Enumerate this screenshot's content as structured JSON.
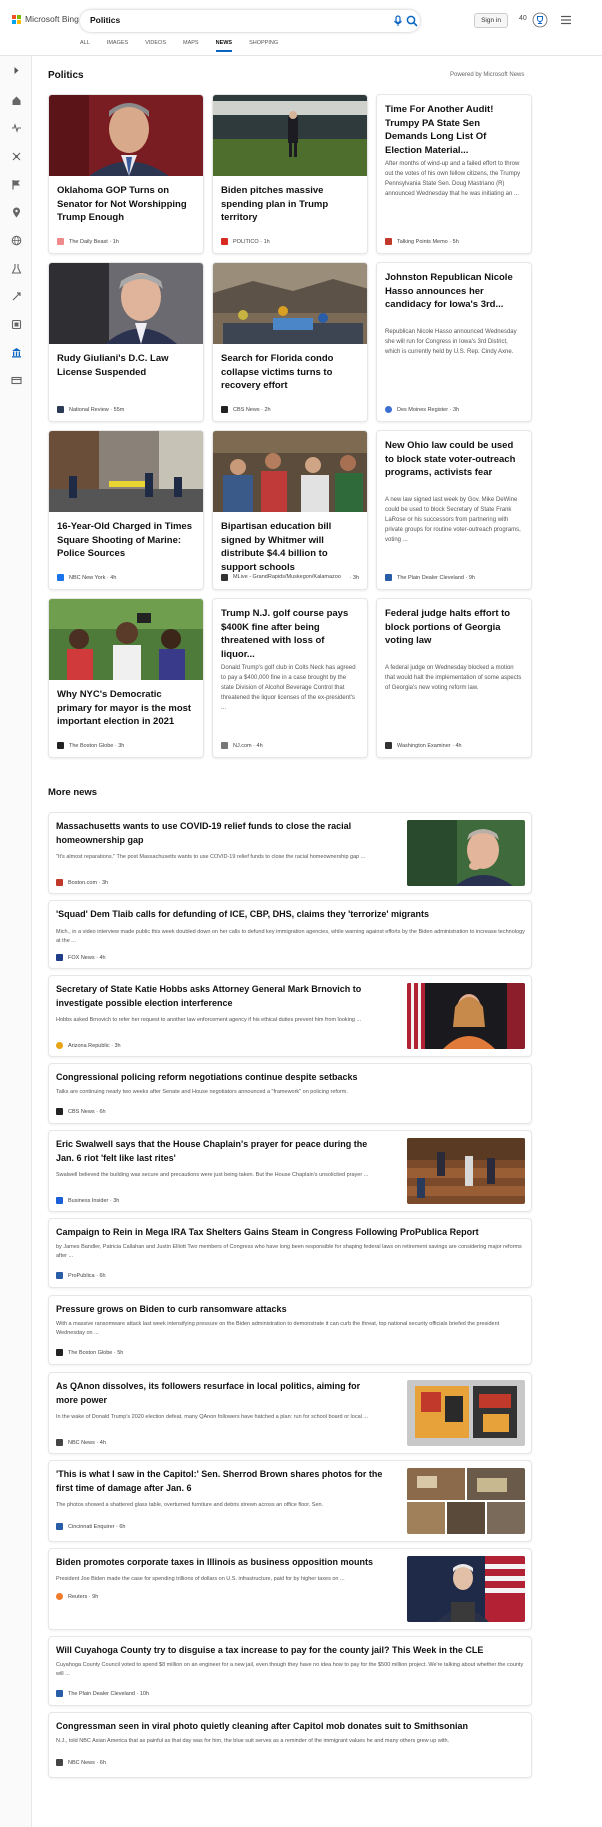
{
  "header": {
    "logo_text": "Microsoft Bing",
    "query": "Politics",
    "signin_label": "Sign in",
    "points": "40",
    "tabs": [
      "ALL",
      "IMAGES",
      "VIDEOS",
      "MAPS",
      "NEWS",
      "SHOPPING"
    ],
    "active_tab": "NEWS"
  },
  "rail_icons": [
    "expand-icon",
    "home-icon",
    "us-news-icon",
    "world-icon",
    "flag-icon",
    "local-icon",
    "globe-icon",
    "science-icon",
    "technology-icon",
    "entertainment-icon",
    "politics-icon",
    "money-icon"
  ],
  "section": {
    "title": "Politics",
    "powered_by": "Powered by Microsoft News"
  },
  "top_cards": [
    {
      "title": "Oklahoma GOP Turns on Senator for Not Worshipping Trump Enough",
      "source": "The Daily Beast",
      "age": "1h",
      "has_image": true,
      "fav_color": "#f08a8a"
    },
    {
      "title": "Biden pitches massive spending plan in Trump territory",
      "source": "POLITICO",
      "age": "1h",
      "has_image": true,
      "fav_color": "#d72a20"
    },
    {
      "title": "Time For Another Audit! Trumpy PA State Sen Demands Long List Of Election Material...",
      "snippet": "After months of wind-up and a failed effort to throw out the votes of his own fellow citizens, the Trumpy Pennsylvania State Sen. Doug Mastriano (R) announced Wednesday that he was initiating an ...",
      "source": "Talking Points Memo",
      "age": "5h",
      "has_image": false,
      "fav_color": "#c0392b"
    },
    {
      "title": "Rudy Giuliani's D.C. Law License Suspended",
      "source": "National Review",
      "age": "55m",
      "has_image": true,
      "fav_color": "#2b3a55"
    },
    {
      "title": "Search for Florida condo collapse victims turns to recovery effort",
      "source": "CBS News",
      "age": "2h",
      "has_image": true,
      "fav_color": "#222222"
    },
    {
      "title": "Johnston Republican Nicole Hasso announces her candidacy for Iowa's 3rd...",
      "snippet": "Republican Nicole Hasso announced Wednesday she will run for Congress in Iowa's 3rd District, which is currently held by U.S. Rep. Cindy Axne.",
      "source": "Des Moines Register",
      "age": "3h",
      "has_image": false,
      "fav_color": "#3b6fd1"
    },
    {
      "title": "16-Year-Old Charged in Times Square Shooting of Marine: Police Sources",
      "source": "NBC New York",
      "age": "4h",
      "has_image": true,
      "fav_color": "#1a73e8"
    },
    {
      "title": "Bipartisan education bill signed by Whitmer will distribute $4.4 billion to support schools",
      "source": "MLive - GrandRapids/Muskegon/Kalamazoo",
      "age": "3h",
      "has_image": true,
      "fav_color": "#333333"
    },
    {
      "title": "New Ohio law could be used to block state voter-outreach programs, activists fear",
      "snippet": "A new law signed last week by Gov. Mike DeWine could be used to block Secretary of State Frank LaRose or his successors from partnering with private groups for routine voter-outreach programs, voting ...",
      "source": "The Plain Dealer Cleveland",
      "age": "9h",
      "has_image": false,
      "fav_color": "#2a5da8"
    },
    {
      "title": "Why NYC's Democratic primary for mayor is the most important election in 2021",
      "source": "The Boston Globe",
      "age": "3h",
      "has_image": true,
      "fav_color": "#222222"
    },
    {
      "title": "Trump N.J. golf course pays $400K fine after being threatened with loss of liquor...",
      "snippet": "Donald Trump's golf club in Colts Neck has agreed to pay a $400,000 fine in a case brought by the state Division of Alcohol Beverage Control that threatened the liquor licenses of the ex-president's ...",
      "source": "NJ.com",
      "age": "4h",
      "has_image": false,
      "fav_color": "#777777"
    },
    {
      "title": "Federal judge halts effort to block portions of Georgia voting law",
      "snippet": "A federal judge on Wednesday blocked a motion that would halt the implementation of some aspects of Georgia's new voting reform law.",
      "source": "Washington Examiner",
      "age": "4h",
      "has_image": false,
      "fav_color": "#333333"
    }
  ],
  "more_news": {
    "title": "More news",
    "items": [
      {
        "title": "Massachusetts wants to use COVID-19 relief funds to close the racial homeownership gap",
        "snippet": "\"It's almost reparations.\" The post Massachusetts wants to use COVID-19 relief funds to close the racial homeownership gap ...",
        "source": "Boston.com",
        "age": "3h",
        "has_image": true,
        "fav_color": "#c0392b"
      },
      {
        "title": "'Squad' Dem Tlaib calls for defunding of ICE, CBP, DHS, claims they 'terrorize' migrants",
        "snippet": "Mich., in a video interview made public this week doubled down on her calls to defund key immigration agencies, while warning against efforts by the Biden administration to increase technology at the ...",
        "source": "FOX News",
        "age": "4h",
        "has_image": false,
        "fav_color": "#1f3c88"
      },
      {
        "title": "Secretary of State Katie Hobbs asks Attorney General Mark Brnovich to investigate possible election interference",
        "snippet": "Hobbs asked Brnovich to refer her request to another law enforcement agency if his ethical duties prevent him from looking ...",
        "source": "Arizona Republic",
        "age": "3h",
        "has_image": true,
        "fav_color": "#e8a317"
      },
      {
        "title": "Congressional policing reform negotiations continue despite setbacks",
        "snippet": "Talks are continuing nearly two weeks after Senate and House negotiators announced a \"framework\" on policing reform.",
        "source": "CBS News",
        "age": "6h",
        "has_image": false,
        "fav_color": "#222222"
      },
      {
        "title": "Eric Swalwell says that the House Chaplain's prayer for peace during the Jan. 6 riot 'felt like last rites'",
        "snippet": "Swalwell believed the building was secure and precautions were just being taken. But the House Chaplain's unsolicited prayer ...",
        "source": "Business Insider",
        "age": "3h",
        "has_image": true,
        "fav_color": "#1a5fd6"
      },
      {
        "title": "Campaign to Rein in Mega IRA Tax Shelters Gains Steam in Congress Following ProPublica Report",
        "snippet": "by James Bandler, Patricia Callahan and Justin Elliott Two members of Congress who have long been responsible for shaping federal laws on retirement savings are considering major reforms after ...",
        "source": "ProPublica",
        "age": "6h",
        "has_image": false,
        "fav_color": "#2a5da8"
      },
      {
        "title": "Pressure grows on Biden to curb ransomware attacks",
        "snippet": "With a massive ransomware attack last week intensifying pressure on the Biden administration to demonstrate it can curb the threat, top national security officials briefed the president Wednesday on ...",
        "source": "The Boston Globe",
        "age": "5h",
        "has_image": false,
        "fav_color": "#222222"
      },
      {
        "title": "As QAnon dissolves, its followers resurface in local politics, aiming for more power",
        "snippet": "In the wake of Donald Trump's 2020 election defeat, many QAnon followers have hatched a plan: run for school board or local ...",
        "source": "NBC News",
        "age": "4h",
        "has_image": true,
        "fav_color": "#444444"
      },
      {
        "title": "'This is what I saw in the Capitol:' Sen. Sherrod Brown shares photos for the first time of damage after Jan. 6",
        "snippet": "The photos showed a shattered glass table, overturned furniture and debris strewn across an office floor.  Sen.",
        "source": "Cincinnati Enquirer",
        "age": "6h",
        "has_image": true,
        "fav_color": "#2a5da8"
      },
      {
        "title": "Biden promotes corporate taxes in Illinois as business opposition mounts",
        "snippet": "President Joe Biden made the case for spending trillions of dollars on U.S. infrastructure, paid for by higher taxes on ...",
        "source": "Reuters",
        "age": "9h",
        "has_image": true,
        "fav_color": "#f07a2a"
      },
      {
        "title": "Will Cuyahoga County try to disguise a tax increase to pay for the county jail? This Week in the CLE",
        "snippet": "Cuyahoga County Council voted to spend $8 million on an engineer for a new jail, even though they have no idea how to pay for the $500 million project. We're talking about whether the county will ...",
        "source": "The Plain Dealer Cleveland",
        "age": "10h",
        "has_image": false,
        "fav_color": "#2a5da8"
      },
      {
        "title": "Congressman seen in viral photo quietly cleaning after Capitol mob donates suit to Smithsonian",
        "snippet": "N.J., told NBC Asian America that as painful as that day was for him, the blue suit serves as a reminder of the immigrant values he and many others grew up with.",
        "source": "NBC News",
        "age": "6h",
        "has_image": false,
        "fav_color": "#444444"
      }
    ]
  }
}
